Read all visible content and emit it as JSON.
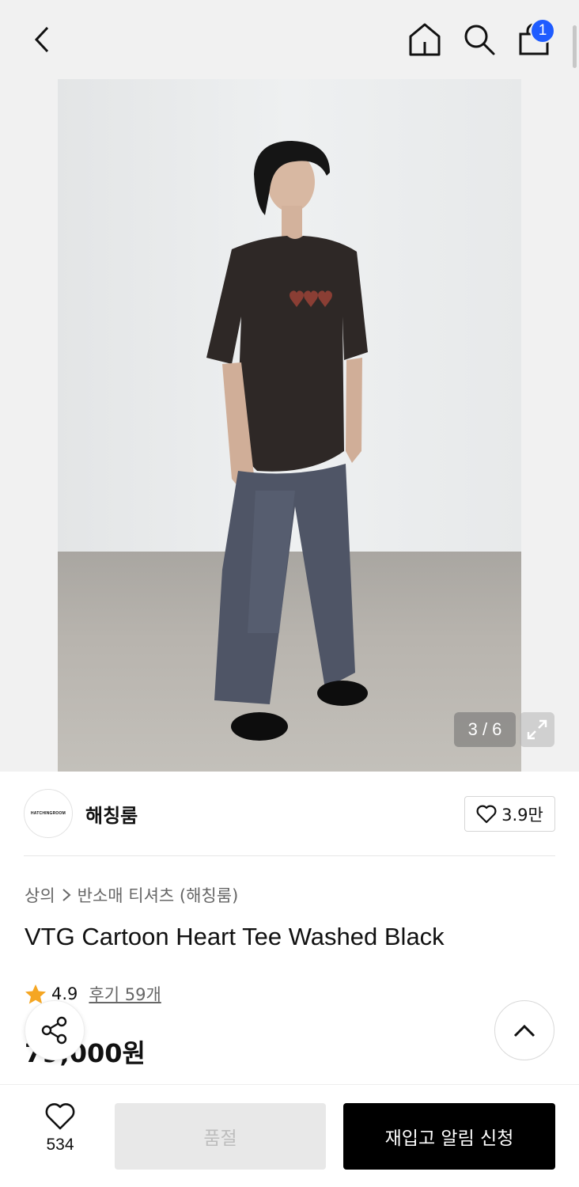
{
  "header": {
    "back_icon": "chevron-left-icon",
    "home_icon": "home-icon",
    "search_icon": "search-icon",
    "cart_icon": "shopping-bag-icon",
    "cart_count": "1",
    "badge_color": "#1f5cff"
  },
  "gallery": {
    "pager": "3 / 6",
    "expand_icon": "expand-icon"
  },
  "brand": {
    "logo_text": "HATCHINGROOM",
    "name": "해칭룸",
    "like_icon": "heart-outline-icon",
    "like_count": "3.9만"
  },
  "product": {
    "breadcrumb": [
      "상의",
      "반소매 티셔츠 (해칭룸)"
    ],
    "title": "VTG Cartoon Heart Tee Washed Black",
    "rating": "4.9",
    "reviews": "후기 59개",
    "star_color": "#f5a623",
    "price": "79,000원"
  },
  "floating": {
    "share_icon": "share-icon",
    "top_icon": "chevron-up-icon"
  },
  "bottom_bar": {
    "wish_icon": "heart-outline-icon",
    "wish_count": "534",
    "soldout_label": "품절",
    "restock_label": "재입고 알림 신청"
  }
}
